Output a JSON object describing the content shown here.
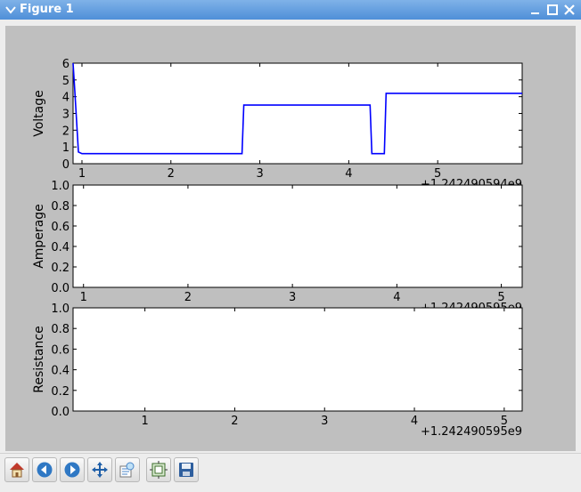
{
  "window": {
    "title": "Figure 1"
  },
  "icons": {
    "menu": "chevron-down-icon",
    "minimize": "minimize-icon",
    "maximize": "maximize-icon",
    "close": "close-icon",
    "home": "home-icon",
    "back": "back-arrow-icon",
    "forward": "forward-arrow-icon",
    "pan": "pan-icon",
    "zoom": "zoom-icon",
    "subplots": "subplots-icon",
    "save": "save-icon"
  },
  "colors": {
    "titlebar": "#5b9be0",
    "line": "#0000ff",
    "canvas": "#bfbfbf"
  },
  "chart_data": [
    {
      "type": "line",
      "ylabel": "Voltage",
      "xlim": [
        0.9,
        5.95
      ],
      "ylim": [
        0,
        6
      ],
      "xticks": [
        "1",
        "2",
        "3",
        "4",
        "5"
      ],
      "xtick_values": [
        1,
        2,
        3,
        4,
        5
      ],
      "yticks": [
        "0",
        "1",
        "2",
        "3",
        "4",
        "5",
        "6"
      ],
      "offset_text": "+1.242490594e9",
      "series": [
        {
          "x": [
            0.9,
            0.92,
            0.96,
            1.0,
            1.5,
            2.0,
            2.5,
            2.8,
            2.82,
            2.85,
            3.0,
            3.5,
            4.0,
            4.24,
            4.26,
            4.3,
            4.4,
            4.42,
            4.5,
            4.6,
            4.65,
            5.0,
            5.5,
            5.95
          ],
          "y": [
            6.0,
            4.3,
            0.7,
            0.6,
            0.6,
            0.6,
            0.6,
            0.6,
            3.5,
            3.5,
            3.5,
            3.5,
            3.5,
            3.5,
            0.6,
            0.6,
            0.6,
            4.2,
            4.2,
            4.2,
            4.2,
            4.2,
            4.2,
            4.2
          ]
        }
      ]
    },
    {
      "type": "line",
      "ylabel": "Amperage",
      "xlim": [
        0.9,
        5.2
      ],
      "ylim": [
        0,
        1
      ],
      "xticks": [
        "1",
        "2",
        "3",
        "4",
        "5"
      ],
      "xtick_values": [
        1,
        2,
        3,
        4,
        5
      ],
      "yticks": [
        "0.0",
        "0.2",
        "0.4",
        "0.6",
        "0.8",
        "1.0"
      ],
      "offset_text": "+1.242490595e9",
      "series": []
    },
    {
      "type": "line",
      "ylabel": "Resistance",
      "xlim": [
        0.2,
        5.2
      ],
      "ylim": [
        0,
        1
      ],
      "xticks": [
        "1",
        "2",
        "3",
        "4",
        "5"
      ],
      "xtick_values": [
        1,
        2,
        3,
        4,
        5
      ],
      "yticks": [
        "0.0",
        "0.2",
        "0.4",
        "0.6",
        "0.8",
        "1.0"
      ],
      "offset_text": "+1.242490595e9",
      "series": []
    }
  ]
}
